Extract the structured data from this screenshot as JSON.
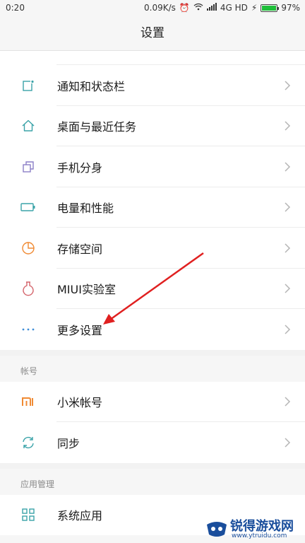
{
  "status_bar": {
    "time": "0:20",
    "speed": "0.09K/s",
    "network": "4G HD",
    "battery": "97%",
    "battery_level": 0.97
  },
  "title": "设置",
  "settings_items": [
    {
      "label": "通知和状态栏",
      "icon": "notification-icon"
    },
    {
      "label": "桌面与最近任务",
      "icon": "home-icon"
    },
    {
      "label": "手机分身",
      "icon": "clone-icon"
    },
    {
      "label": "电量和性能",
      "icon": "battery-icon"
    },
    {
      "label": "存储空间",
      "icon": "storage-pie-icon"
    },
    {
      "label": "MIUI实验室",
      "icon": "lab-flask-icon"
    },
    {
      "label": "更多设置",
      "icon": "more-dots-icon"
    }
  ],
  "account_section": {
    "header": "帐号",
    "items": [
      {
        "label": "小米帐号",
        "icon": "mi-logo-icon"
      },
      {
        "label": "同步",
        "icon": "sync-icon"
      }
    ]
  },
  "app_section": {
    "header": "应用管理",
    "items": [
      {
        "label": "系统应用",
        "icon": "grid-apps-icon"
      }
    ]
  },
  "watermark": {
    "name": "锐得游戏网",
    "url": "www.ytruidu.com"
  },
  "colors": {
    "teal": "#3aa3a8",
    "lavender": "#8b7fc7",
    "orange": "#f08a33",
    "pink": "#d4646b",
    "blue": "#3f8ed8",
    "arrow": "#e02020"
  }
}
